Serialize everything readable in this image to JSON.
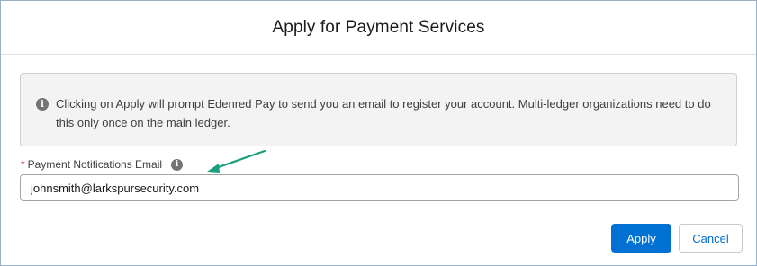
{
  "modal": {
    "title": "Apply for Payment Services",
    "info": {
      "icon": "info-icon",
      "text": "Clicking on Apply will prompt Edenred Pay to send you an email to register your account. Multi-ledger organizations need to do this only once on the main ledger."
    },
    "field": {
      "required_marker": "*",
      "label": "Payment Notifications Email",
      "help_icon": "info-icon",
      "value": "johnsmith@larkspursecurity.com"
    },
    "buttons": {
      "apply_label": "Apply",
      "cancel_label": "Cancel"
    },
    "annotation": {
      "icon": "arrow-icon",
      "color": "#1a9e7e"
    }
  },
  "colors": {
    "brand": "#0070d2",
    "required": "#c23934",
    "info_bg": "#f3f3f3"
  }
}
